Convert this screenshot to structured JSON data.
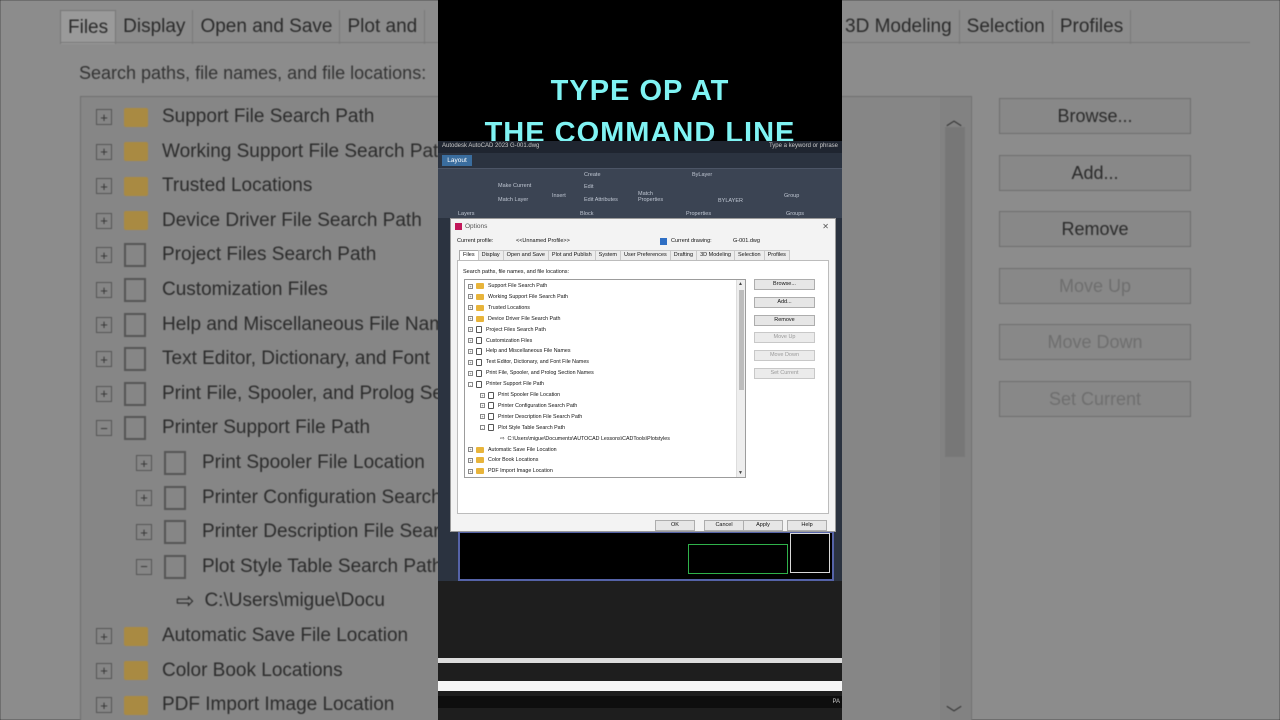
{
  "overlay_title": [
    "TYPE OP AT",
    "THE COMMAND LINE"
  ],
  "background": {
    "tabs": [
      "Files",
      "Display",
      "Open and Save",
      "Plot and"
    ],
    "tabs_right": [
      "3D Modeling",
      "Selection",
      "Profiles"
    ],
    "caption": "Search paths, file names, and file locations:",
    "rows": [
      {
        "label": "Support File Search Path",
        "icon": "folder-icon",
        "indent": 0
      },
      {
        "label": "Working Support File Search Pat",
        "icon": "folder-icon",
        "indent": 0
      },
      {
        "label": "Trusted Locations",
        "icon": "folder-icon",
        "indent": 0
      },
      {
        "label": "Device Driver File Search Path",
        "icon": "folder-icon",
        "indent": 0
      },
      {
        "label": "Project Files Search Path",
        "icon": "document-icon",
        "indent": 0
      },
      {
        "label": "Customization Files",
        "icon": "document-icon",
        "indent": 0
      },
      {
        "label": "Help and Miscellaneous File Nam",
        "icon": "document-icon",
        "indent": 0
      },
      {
        "label": "Text Editor, Dictionary, and Font",
        "icon": "document-icon",
        "indent": 0
      },
      {
        "label": "Print File, Spooler, and Prolog Se",
        "icon": "document-icon",
        "indent": 0
      },
      {
        "label": "Printer Support File Path",
        "icon": "document-icon",
        "indent": 0
      },
      {
        "label": "Print Spooler File Location",
        "icon": "plt-icon",
        "indent": 1
      },
      {
        "label": "Printer Configuration Search",
        "icon": "plt-icon",
        "indent": 1
      },
      {
        "label": "Printer Description File Sear",
        "icon": "plt-icon",
        "indent": 1
      },
      {
        "label": "Plot Style Table Search Path",
        "icon": "plt-icon",
        "indent": 1
      },
      {
        "label": "C:\\Users\\migue\\Docu",
        "icon": "arrow-icon",
        "indent": 2
      },
      {
        "label": "Automatic Save File Location",
        "icon": "folder-icon",
        "indent": 0
      },
      {
        "label": "Color Book Locations",
        "icon": "folder-icon",
        "indent": 0
      },
      {
        "label": "PDF Import Image Location",
        "icon": "folder-icon",
        "indent": 0
      }
    ],
    "buttons": [
      {
        "label": "Browse...",
        "enabled": true
      },
      {
        "label": "Add...",
        "enabled": true
      },
      {
        "label": "Remove",
        "enabled": true
      },
      {
        "label": "Move Up",
        "enabled": false
      },
      {
        "label": "Move Down",
        "enabled": false
      },
      {
        "label": "Set Current",
        "enabled": false
      }
    ]
  },
  "app": {
    "title_bar": "Autodesk AutoCAD 2023   G-001.dwg",
    "search_hint": "Type a keyword or phrase",
    "layout_tab": "Layout",
    "ribbon_labels": [
      "Make Current",
      "Match Layer",
      "Create",
      "Edit",
      "Edit Attributes",
      "Insert",
      "Match Properties",
      "ByLayer",
      "BYLAYER",
      "Group",
      "Layers",
      "Block",
      "Properties",
      "Groups"
    ],
    "status_text": "PA"
  },
  "dialog": {
    "title": "Options",
    "current_profile_label": "Current profile:",
    "current_profile": "<<Unnamed Profile>>",
    "current_drawing_label": "Current drawing:",
    "current_drawing": "G-001.dwg",
    "tabs": [
      "Files",
      "Display",
      "Open and Save",
      "Plot and Publish",
      "System",
      "User Preferences",
      "Drafting",
      "3D Modeling",
      "Selection",
      "Profiles"
    ],
    "caption": "Search paths, file names, and file locations:",
    "tree": [
      {
        "label": "Support File Search Path",
        "icon": "folder",
        "indent": 0,
        "pm": "+"
      },
      {
        "label": "Working Support File Search Path",
        "icon": "folder",
        "indent": 0,
        "pm": "+"
      },
      {
        "label": "Trusted Locations",
        "icon": "folder",
        "indent": 0,
        "pm": "+"
      },
      {
        "label": "Device Driver File Search Path",
        "icon": "folder",
        "indent": 0,
        "pm": "+"
      },
      {
        "label": "Project Files Search Path",
        "icon": "doc",
        "indent": 0,
        "pm": "+"
      },
      {
        "label": "Customization Files",
        "icon": "doc",
        "indent": 0,
        "pm": "+"
      },
      {
        "label": "Help and Miscellaneous File Names",
        "icon": "doc",
        "indent": 0,
        "pm": "+"
      },
      {
        "label": "Text Editor, Dictionary, and Font File Names",
        "icon": "doc",
        "indent": 0,
        "pm": "+"
      },
      {
        "label": "Print File, Spooler, and Prolog Section Names",
        "icon": "doc",
        "indent": 0,
        "pm": "+"
      },
      {
        "label": "Printer Support File Path",
        "icon": "doc",
        "indent": 0,
        "pm": "-"
      },
      {
        "label": "Print Spooler File Location",
        "icon": "doc",
        "indent": 1,
        "pm": "+"
      },
      {
        "label": "Printer Configuration Search Path",
        "icon": "doc",
        "indent": 1,
        "pm": "+"
      },
      {
        "label": "Printer Description File Search Path",
        "icon": "doc",
        "indent": 1,
        "pm": "+"
      },
      {
        "label": "Plot Style Table Search Path",
        "icon": "doc",
        "indent": 1,
        "pm": "-"
      },
      {
        "label": "C:\\Users\\migue\\Documents\\AUTOCAD Lessons\\CADTools\\Plotstyles",
        "icon": "arrow",
        "indent": 2,
        "pm": ""
      },
      {
        "label": "Automatic Save File Location",
        "icon": "folder",
        "indent": 0,
        "pm": "+"
      },
      {
        "label": "Color Book Locations",
        "icon": "folder",
        "indent": 0,
        "pm": "+"
      },
      {
        "label": "PDF Import Image Location",
        "icon": "folder",
        "indent": 0,
        "pm": "+"
      }
    ],
    "side_buttons": [
      {
        "label": "Browse...",
        "enabled": true
      },
      {
        "label": "Add...",
        "enabled": true
      },
      {
        "label": "Remove",
        "enabled": true
      },
      {
        "label": "Move Up",
        "enabled": false
      },
      {
        "label": "Move Down",
        "enabled": false
      },
      {
        "label": "Set Current",
        "enabled": false
      }
    ],
    "footer_buttons": [
      "OK",
      "Cancel",
      "Apply",
      "Help"
    ]
  }
}
